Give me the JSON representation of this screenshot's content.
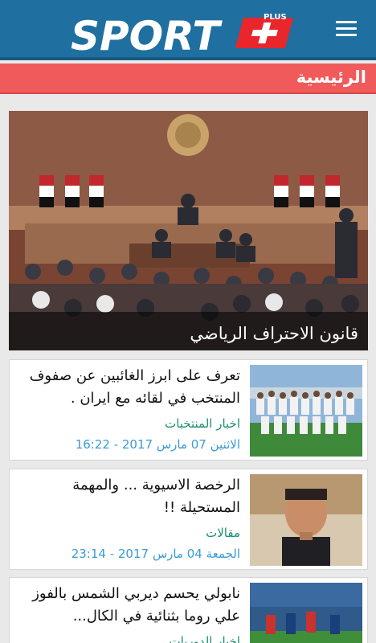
{
  "header": {
    "logo_main": "SPORT",
    "logo_plus": "PLUS",
    "menu_icon": "hamburger-menu-icon"
  },
  "section": {
    "title": "الرئيسية"
  },
  "hero": {
    "caption": "قانون الاحتراف الرياضي"
  },
  "articles": [
    {
      "headline": "تعرف على ابرز الغائبين عن صفوف المنتخب في لقائه مع ايران .",
      "category": "اخبار المنتخبات",
      "date": "الاثنين  07 مارس 2017 - 16:22"
    },
    {
      "headline": "الرخصة الاسيوية ... والمهمة المستحيلة !!",
      "category": "مقالات",
      "date": "الجمعة  04 مارس 2017 - 23:14"
    },
    {
      "headline": "نابولي يحسم ديربي الشمس بالفوز علي روما بثنائية في الكال...",
      "category": "اخبار الدوريات",
      "date": ""
    }
  ],
  "colors": {
    "header_blue": "#1f6fa0",
    "section_red": "#f05a5a",
    "category_green": "#1e8f6f",
    "date_blue": "#3a9bd5"
  }
}
